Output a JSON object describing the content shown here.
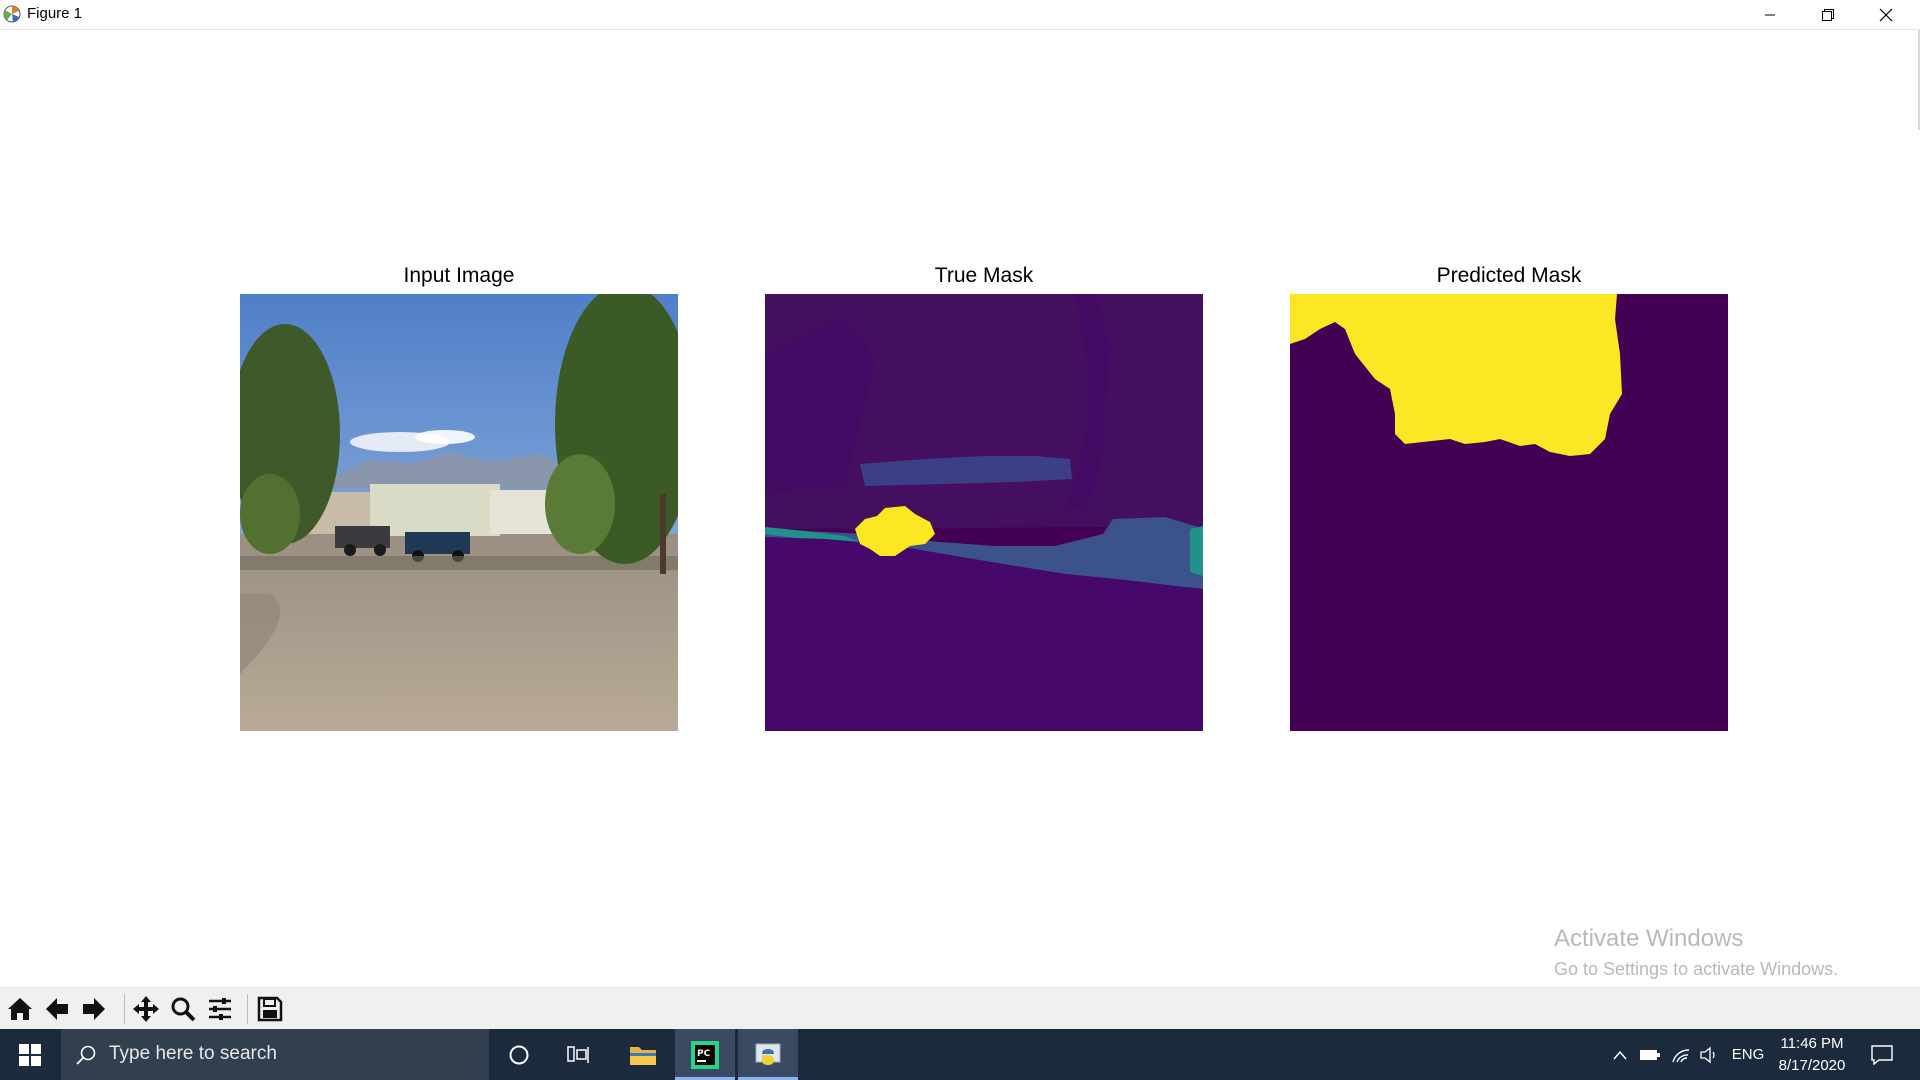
{
  "window": {
    "title": "Figure 1",
    "controls": {
      "minimize": "minimize-icon",
      "restore": "restore-icon",
      "close": "close-icon"
    }
  },
  "figure": {
    "panels": [
      {
        "title": "Input Image",
        "content": "photo of a gravel lot with trailer homes, parked trucks and trees"
      },
      {
        "title": "True Mask",
        "content": "segmentation mask"
      },
      {
        "title": "Predicted Mask",
        "content": "segmentation mask"
      }
    ],
    "colors": {
      "mask_background": "#440154",
      "mask_purple": "#46086a",
      "mask_blue": "#3b528b",
      "mask_teal": "#21918c",
      "mask_yellow": "#fde725"
    }
  },
  "toolbar": {
    "buttons": [
      {
        "name": "home",
        "icon": "home-icon"
      },
      {
        "name": "back",
        "icon": "back-arrow-icon"
      },
      {
        "name": "forward",
        "icon": "forward-arrow-icon"
      },
      {
        "name": "pan",
        "icon": "move-icon"
      },
      {
        "name": "zoom",
        "icon": "magnifier-icon"
      },
      {
        "name": "configure-subplots",
        "icon": "sliders-icon"
      },
      {
        "name": "save",
        "icon": "floppy-disk-icon"
      }
    ]
  },
  "watermark": {
    "line1": "Activate Windows",
    "line2": "Go to Settings to activate Windows."
  },
  "taskbar": {
    "search_placeholder": "Type here to search",
    "apps": [
      "cortana-icon",
      "task-view-icon",
      "file-explorer-icon",
      "pycharm-icon",
      "python-icon"
    ],
    "tray": {
      "language": "ENG",
      "time": "11:46 PM",
      "date": "8/17/2020"
    }
  }
}
